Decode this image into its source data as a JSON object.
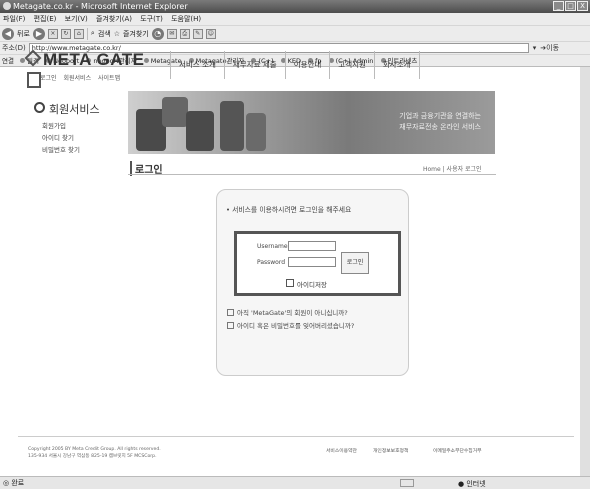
{
  "window": {
    "title": "Metagate.co.kr - Microsoft Internet Explorer",
    "buttons": [
      "_",
      "□",
      "X"
    ]
  },
  "menu": [
    "파일(F)",
    "편집(E)",
    "보기(V)",
    "즐겨찾기(A)",
    "도구(T)",
    "도움말(H)"
  ],
  "toolbar": {
    "back_label": "뒤로",
    "search_label": "검색",
    "favorites_label": "즐겨찾기"
  },
  "address": {
    "label": "주소(D)",
    "url": "http://www.metagate.co.kr/",
    "go_label": "이동"
  },
  "links": {
    "label": "연결",
    "items": [
      "원격",
      "Neoport",
      "neoport관리자",
      "Metagate",
      "Metagate관리자",
      "(C+)",
      "KED",
      "fp",
      "(C+) Admin",
      "인트라넷츠"
    ]
  },
  "site": {
    "logo": "META GATE",
    "logo_links": [
      "로그인",
      "회원서비스",
      "사이트맵"
    ],
    "gnb": [
      "서비스 소개",
      "재무자료 제출",
      "이용안내",
      "고객지원",
      "회사소개"
    ],
    "sidebar": {
      "title": "회원서비스",
      "items": [
        "회원가입",
        "아이디 찾기",
        "비밀번호 찾기"
      ]
    },
    "banner": {
      "line1": "기업과 금융기관을 연결하는",
      "line2": "재무자료전송 온라인 서비스"
    },
    "page_title": "로그인",
    "breadcrumb": "Home | 사용자 로그인"
  },
  "login": {
    "headline": "• 서비스를 이용하시려면 로그인을 해주세요",
    "username_label": "Username",
    "password_label": "Password",
    "username_value": "",
    "password_value": "",
    "login_button": "로그인",
    "remember_label": "아이디저장",
    "link1": "아직 'MetaGate'의 회원이 아니십니까?",
    "link2": "아이디 혹은 비밀번호를 잊어버리셨습니까?"
  },
  "footer": {
    "copyright": "Copyright 2005 BY Meta Credit Group. All rights reserved.",
    "address": "135-934 서울시 강남구 역삼동 825-19 캠브릿지 5F MCSCorp.",
    "links": [
      "서비스이용약관",
      "개인정보보호정책",
      "이메일주소무단수집거부"
    ]
  },
  "status": {
    "text": "완료",
    "zone": "인터넷"
  }
}
